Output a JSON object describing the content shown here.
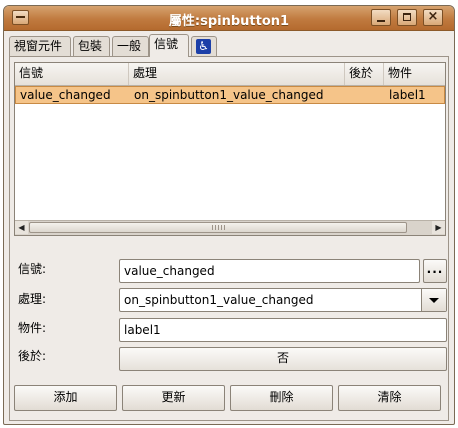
{
  "window": {
    "title": "屬性:spinbutton1"
  },
  "tabs": [
    {
      "label": "視窗元件"
    },
    {
      "label": "包裝"
    },
    {
      "label": "一般"
    },
    {
      "label": "信號"
    },
    {
      "label": "",
      "icon": "accessibility-icon"
    }
  ],
  "active_tab": "信號",
  "signals_table": {
    "columns": [
      "信號",
      "處理",
      "後於",
      "物件"
    ],
    "rows": [
      {
        "signal": "value_changed",
        "handler": "on_spinbutton1_value_changed",
        "after": "",
        "object": "label1"
      }
    ]
  },
  "form": {
    "signal_label": "信號:",
    "signal_value": "value_changed",
    "browse_label": "...",
    "handler_label": "處理:",
    "handler_value": "on_spinbutton1_value_changed",
    "object_label": "物件:",
    "object_value": "label1",
    "after_label": "後於:",
    "after_value": "否"
  },
  "buttons": {
    "add": "添加",
    "update": "更新",
    "delete": "刪除",
    "clear": "清除"
  },
  "colors": {
    "titlebar": "#c07a3f",
    "selection": "#f5c489",
    "background": "#efebe7"
  }
}
